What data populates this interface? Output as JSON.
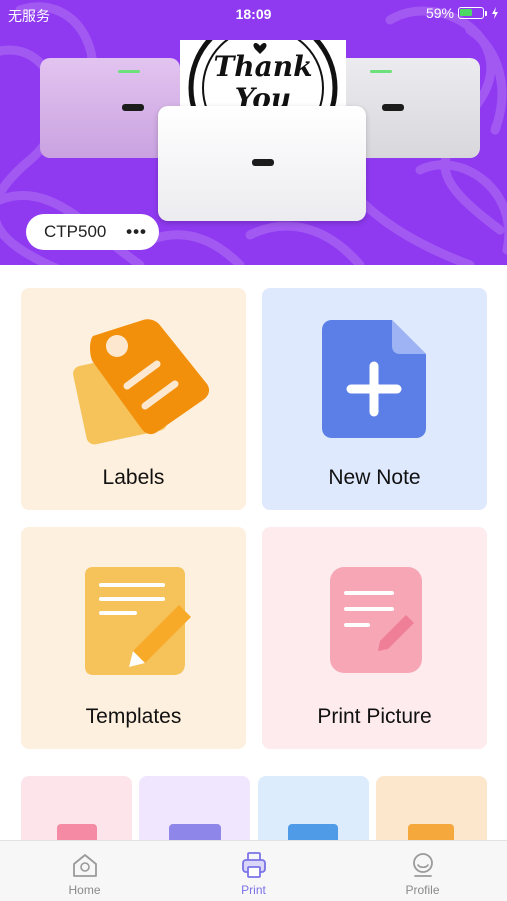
{
  "status_bar": {
    "carrier": "无服务",
    "time": "18:09",
    "battery_percent": "59%",
    "battery_level": 0.59
  },
  "hero": {
    "device_name": "CTP500",
    "more_label": "•••",
    "paper_text_line1": "Thank",
    "paper_text_line2": "You"
  },
  "tiles": [
    {
      "label": "Labels",
      "icon": "price-tag-icon"
    },
    {
      "label": "New Note",
      "icon": "add-document-icon"
    },
    {
      "label": "Templates",
      "icon": "note-edit-icon"
    },
    {
      "label": "Print Picture",
      "icon": "picture-edit-icon"
    }
  ],
  "tab_bar": {
    "items": [
      {
        "label": "Home",
        "icon": "home-icon",
        "active": false
      },
      {
        "label": "Print",
        "icon": "printer-icon",
        "active": true
      },
      {
        "label": "Profile",
        "icon": "profile-icon",
        "active": false
      }
    ]
  },
  "colors": {
    "hero_purple": "#8f3af0",
    "active_tab": "#7b73e6",
    "labels_orange": "#f3900b",
    "note_blue": "#5b7fe6"
  }
}
